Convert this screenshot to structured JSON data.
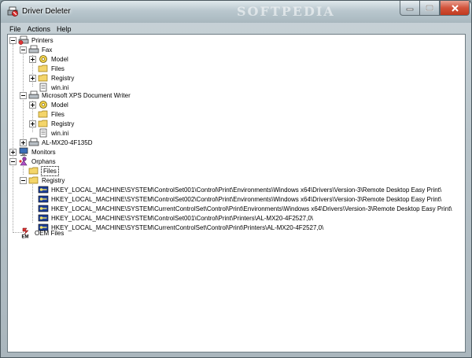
{
  "window": {
    "title": "Driver Deleter",
    "watermark": "SOFTPEDIA"
  },
  "menu": [
    "File",
    "Actions",
    "Help"
  ],
  "tree": {
    "printers": "Printers",
    "fax": "Fax",
    "fax_model": "Model",
    "fax_files": "Files",
    "fax_registry": "Registry",
    "fax_winini": "win.ini",
    "xps": "Microsoft XPS Document Writer",
    "xps_model": "Model",
    "xps_files": "Files",
    "xps_registry": "Registry",
    "xps_winini": "win.ini",
    "almx": "AL-MX20-4F135D",
    "monitors": "Monitors",
    "orphans": "Orphans",
    "orphans_files": "Files",
    "orphans_registry": "Registry",
    "reg_keys": [
      "HKEY_LOCAL_MACHINE\\SYSTEM\\ControlSet001\\Control\\Print\\Environments\\Windows x64\\Drivers\\Version-3\\Remote Desktop Easy Print\\",
      "HKEY_LOCAL_MACHINE\\SYSTEM\\ControlSet002\\Control\\Print\\Environments\\Windows x64\\Drivers\\Version-3\\Remote Desktop Easy Print\\",
      "HKEY_LOCAL_MACHINE\\SYSTEM\\CurrentControlSet\\Control\\Print\\Environments\\Windows x64\\Drivers\\Version-3\\Remote Desktop Easy Print\\",
      "HKEY_LOCAL_MACHINE\\SYSTEM\\ControlSet001\\Control\\Print\\Printers\\AL-MX20-4F2527,0\\",
      "HKEY_LOCAL_MACHINE\\SYSTEM\\CurrentControlSet\\Control\\Print\\Printers\\AL-MX20-4F2527,0\\"
    ],
    "oem_files": "OEM Files",
    "oem_badge": "EM"
  },
  "icons": {
    "printer": "printer-icon",
    "model": "model-gear-icon",
    "folder": "folder-icon",
    "ini": "ini-file-icon",
    "monitor": "monitor-icon",
    "orphans": "orphans-icon",
    "regkey": "registry-key-icon",
    "oem": "oem-icon"
  },
  "colors": {
    "close_button": "#c23a1f",
    "folder": "#f4d56a",
    "selection_outline": "#000000"
  }
}
